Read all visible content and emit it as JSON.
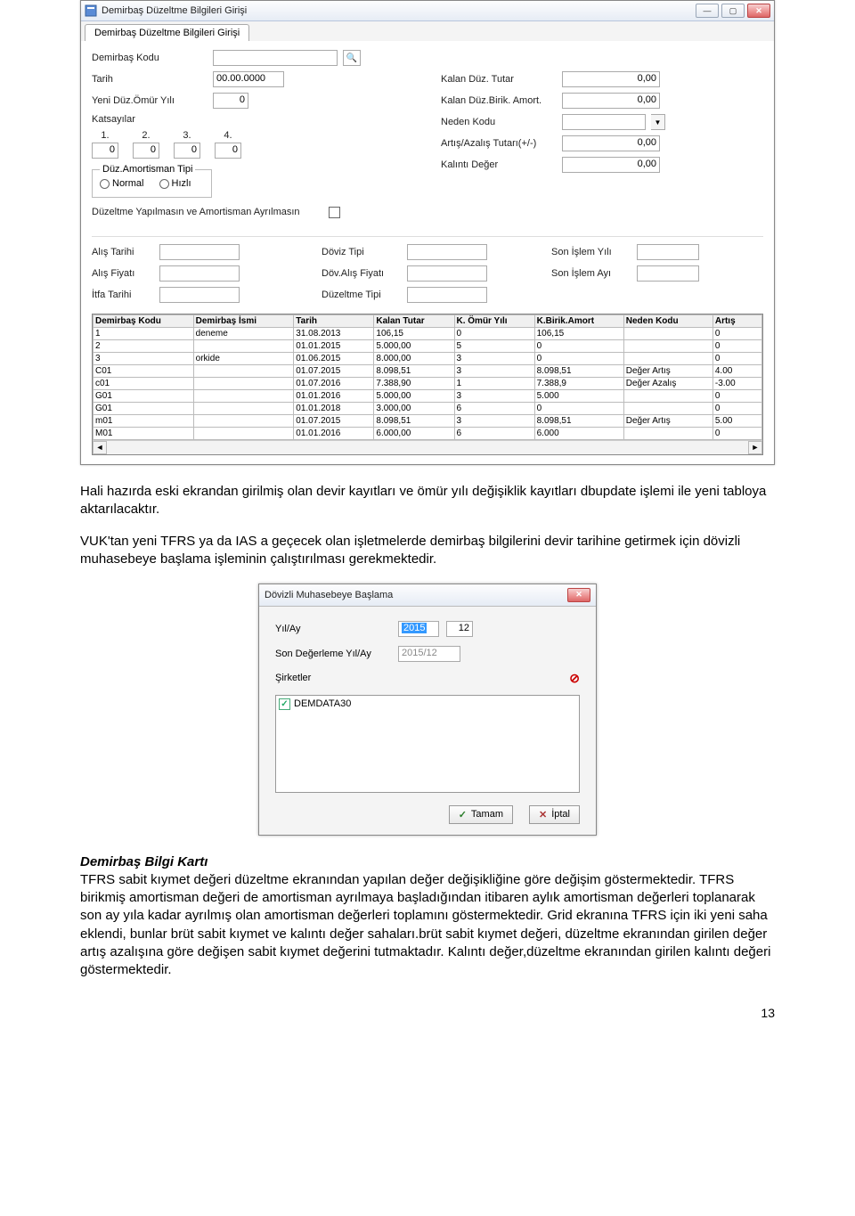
{
  "window1": {
    "title": "Demirbaş Düzeltme Bilgileri Girişi",
    "tab": "Demirbaş Düzeltme Bilgileri Girişi",
    "left": {
      "demirbas_kodu": "Demirbaş Kodu",
      "tarih": "Tarih",
      "tarih_val": "00.00.0000",
      "yeni_duz_omur": "Yeni Düz.Ömür Yılı",
      "yeni_duz_omur_val": "0",
      "katsayilar": "Katsayılar",
      "k1": "1.",
      "k2": "2.",
      "k3": "3.",
      "k4": "4.",
      "kv": "0",
      "amort_tipi": "Düz.Amortisman Tipi",
      "normal": "Normal",
      "hizli": "Hızlı",
      "duzeltme_yapilmasin": "Düzeltme Yapılmasın ve Amortisman Ayrılmasın"
    },
    "right": {
      "kalan_duz_tutar": "Kalan Düz. Tutar",
      "kalan_duz_tutar_val": "0,00",
      "kalan_duz_birik": "Kalan Düz.Birik. Amort.",
      "kalan_duz_birik_val": "0,00",
      "neden_kodu": "Neden Kodu",
      "artis_azalis": "Artış/Azalış Tutarı(+/-)",
      "artis_azalis_val": "0,00",
      "kalinti_deger": "Kalıntı Değer",
      "kalinti_deger_val": "0,00"
    },
    "mid": {
      "alis_tarihi": "Alış Tarihi",
      "alis_fiyati": "Alış Fiyatı",
      "itfa_tarihi": "İtfa Tarihi",
      "doviz_tipi": "Döviz Tipi",
      "dov_alis_fiyati": "Döv.Alış Fiyatı",
      "duzeltme_tipi": "Düzeltme Tipi",
      "son_islem_yili": "Son İşlem Yılı",
      "son_islem_ayi": "Son İşlem Ayı"
    },
    "grid": {
      "cols": [
        "Demirbaş Kodu",
        "Demirbaş İsmi",
        "Tarih",
        "Kalan Tutar",
        "K. Ömür Yılı",
        "K.Birik.Amort",
        "Neden Kodu",
        "Artış"
      ],
      "rows": [
        [
          "1",
          "deneme",
          "31.08.2013",
          "106,15",
          "0",
          "106,15",
          "",
          "0"
        ],
        [
          "2",
          "",
          "01.01.2015",
          "5.000,00",
          "5",
          "0",
          "",
          "0"
        ],
        [
          "3",
          "orkide",
          "01.06.2015",
          "8.000,00",
          "3",
          "0",
          "",
          "0"
        ],
        [
          "C01",
          "",
          "01.07.2015",
          "8.098,51",
          "3",
          "8.098,51",
          "Değer Artış",
          "4.00"
        ],
        [
          "c01",
          "",
          "01.07.2016",
          "7.388,90",
          "1",
          "7.388,9",
          "Değer Azalış",
          "-3.00"
        ],
        [
          "G01",
          "",
          "01.01.2016",
          "5.000,00",
          "3",
          "5.000",
          "",
          "0"
        ],
        [
          "G01",
          "",
          "01.01.2018",
          "3.000,00",
          "6",
          "0",
          "",
          "0"
        ],
        [
          "m01",
          "",
          "01.07.2015",
          "8.098,51",
          "3",
          "8.098,51",
          "Değer Artış",
          "5.00"
        ],
        [
          "M01",
          "",
          "01.01.2016",
          "6.000,00",
          "6",
          "6.000",
          "",
          "0"
        ]
      ]
    }
  },
  "para1": "Hali hazırda eski ekrandan girilmiş olan devir kayıtları ve ömür yılı değişiklik kayıtları dbupdate işlemi ile yeni tabloya aktarılacaktır.",
  "para2": "VUK'tan yeni TFRS ya da IAS a geçecek olan işletmelerde demirbaş bilgilerini devir tarihine getirmek için dövizli muhasebeye başlama işleminin çalıştırılması gerekmektedir.",
  "dialog": {
    "title": "Dövizli Muhasebeye Başlama",
    "yil_ay": "Yıl/Ay",
    "yil_val": "2015",
    "ay_val": "12",
    "son_deg": "Son Değerleme Yıl/Ay",
    "son_deg_val": "2015/12",
    "sirketler": "Şirketler",
    "company": "DEMDATA30",
    "tamam": "Tamam",
    "iptal": "İptal"
  },
  "section_title": "Demirbaş Bilgi Kartı",
  "para3": "TFRS sabit kıymet değeri düzeltme ekranından yapılan değer değişikliğine göre değişim göstermektedir. TFRS birikmiş amortisman değeri de amortisman ayrılmaya başladığından itibaren aylık amortisman değerleri toplanarak son ay yıla kadar ayrılmış olan amortisman değerleri toplamını göstermektedir. Grid ekranına TFRS için iki yeni saha eklendi, bunlar brüt sabit kıymet ve kalıntı değer sahaları.brüt sabit kıymet değeri, düzeltme ekranından girilen değer artış azalışına göre değişen sabit kıymet değerini tutmaktadır. Kalıntı değer,düzeltme ekranından girilen kalıntı değeri göstermektedir.",
  "page_num": "13"
}
